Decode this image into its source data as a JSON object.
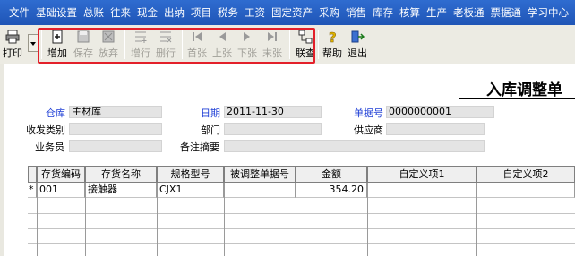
{
  "menu": [
    "文件",
    "基础设置",
    "总账",
    "往来",
    "现金",
    "出纳",
    "项目",
    "税务",
    "工资",
    "固定资产",
    "采购",
    "销售",
    "库存",
    "核算",
    "生产",
    "老板通",
    "票据通",
    "学习中心"
  ],
  "toolbar": {
    "print": "打印",
    "add": "增加",
    "save": "保存",
    "discard": "放弃",
    "add_row": "增行",
    "delete_row": "删行",
    "first": "首张",
    "prev": "上张",
    "next": "下张",
    "last": "末张",
    "link": "联查",
    "help": "帮助",
    "exit": "退出"
  },
  "form": {
    "title": "入库调整单",
    "warehouse_label": "仓库",
    "warehouse_value": "主材库",
    "date_label": "日期",
    "date_value": "2011-11-30",
    "docno_label": "单据号",
    "docno_value": "0000000001",
    "category_label": "收发类别",
    "category_value": "",
    "dept_label": "部门",
    "dept_value": "",
    "supplier_label": "供应商",
    "supplier_value": "",
    "clerk_label": "业务员",
    "clerk_value": "",
    "remark_label": "备注摘要",
    "remark_value": ""
  },
  "grid": {
    "headers": [
      "存货编码",
      "存货名称",
      "规格型号",
      "被调整单据号",
      "金额",
      "自定义项1",
      "自定义项2"
    ],
    "rows": [
      {
        "marker": "*",
        "code": "001",
        "name": "接触器",
        "spec": "CJX1",
        "ref": "",
        "amount": "354.20",
        "c1": "",
        "c2": ""
      }
    ]
  },
  "colors": {
    "menubar": "#2f6cd0",
    "toolbar": "#ecebe3",
    "highlight": "#e3202a",
    "label_blue": "#1f3fd6",
    "field_bg": "#e4e4e4"
  }
}
